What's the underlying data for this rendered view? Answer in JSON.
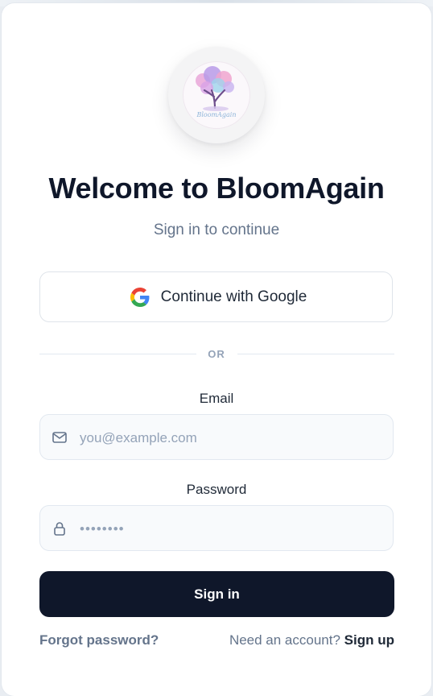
{
  "logo": {
    "text": "BloomAgain"
  },
  "title": "Welcome to BloomAgain",
  "subtitle": "Sign in to continue",
  "google_button": {
    "label": "Continue with Google"
  },
  "divider": {
    "label": "OR"
  },
  "email": {
    "label": "Email",
    "placeholder": "you@example.com"
  },
  "password": {
    "label": "Password",
    "value": "••••••••"
  },
  "signin_button": {
    "label": "Sign in"
  },
  "footer": {
    "forgot_label": "Forgot password?",
    "need_account": "Need an account?",
    "signup_label": "Sign up"
  },
  "colors": {
    "primary_button": "#0f172a",
    "muted_text": "#64748b",
    "field_bg": "#f8fafc"
  },
  "icons": [
    "google-icon",
    "mail-icon",
    "lock-icon",
    "tree-logo"
  ]
}
